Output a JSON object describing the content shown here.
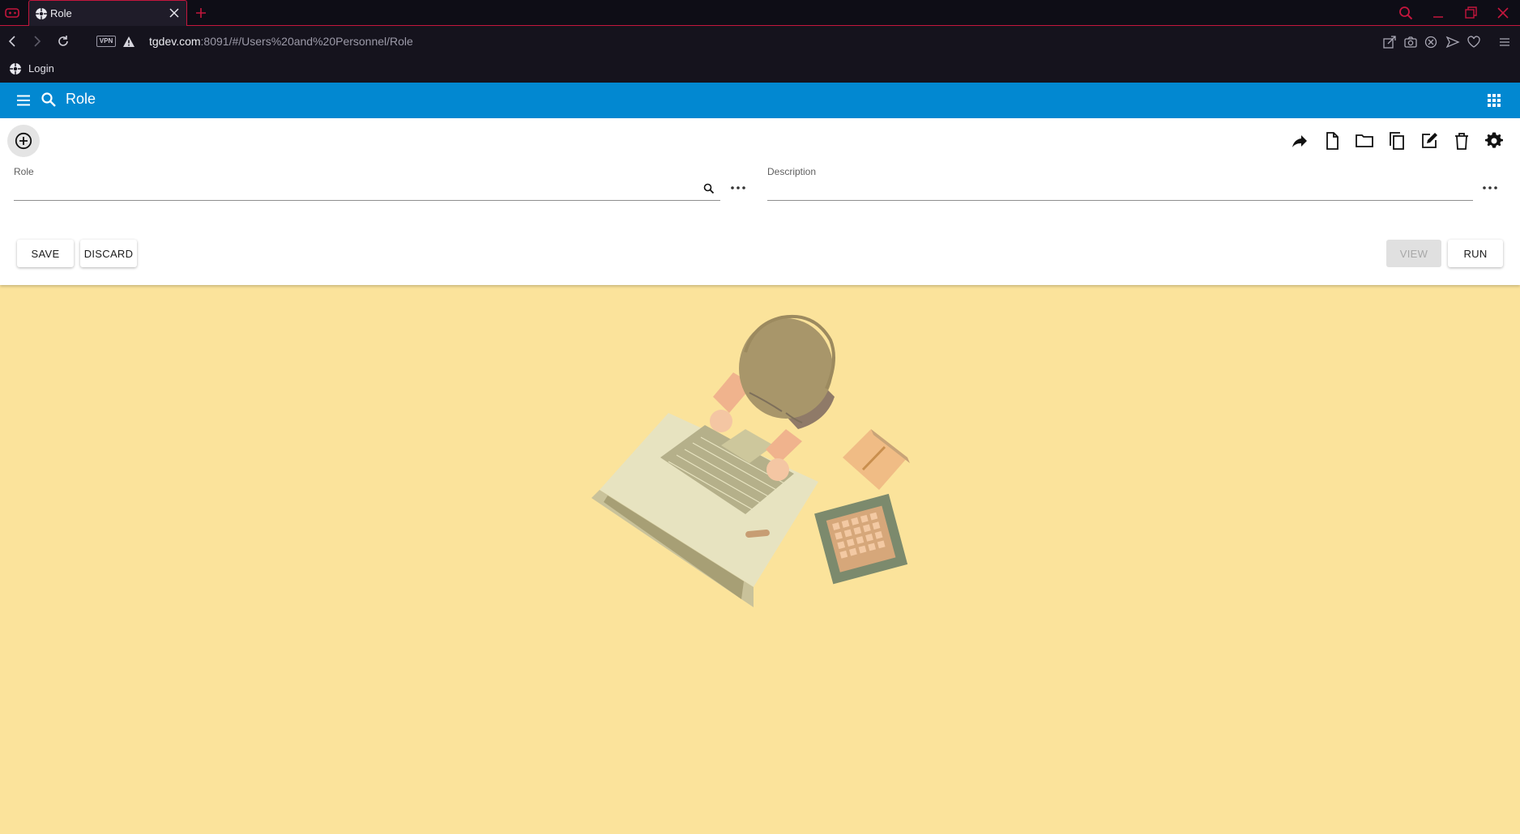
{
  "browser": {
    "tab_title": "Role",
    "url_host": "tgdev.com",
    "url_path": ":8091/#/Users%20and%20Personnel/Role",
    "vpn_label": "VPN",
    "bookmark_label": "Login",
    "accent_color": "#c4163d"
  },
  "app": {
    "title": "Role",
    "header_color": "#0288d1",
    "background_color": "#fbe39b"
  },
  "form": {
    "role_label": "Role",
    "role_value": "",
    "description_label": "Description",
    "description_value": ""
  },
  "actions": {
    "save_label": "SAVE",
    "discard_label": "DISCARD",
    "view_label": "VIEW",
    "run_label": "RUN"
  },
  "toolbar_icons": [
    "share-icon",
    "new-document-icon",
    "open-folder-icon",
    "copy-icon",
    "edit-icon",
    "delete-icon",
    "settings-icon"
  ]
}
